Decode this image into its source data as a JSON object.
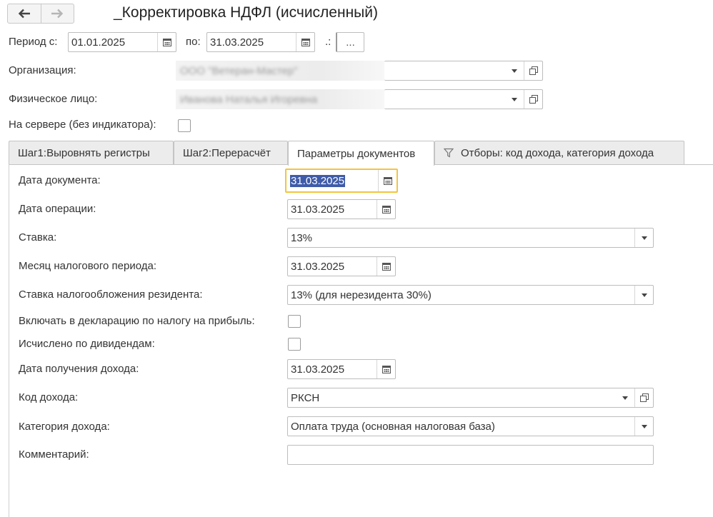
{
  "window": {
    "title": "_Корректировка НДФЛ (исчисленный)"
  },
  "period": {
    "from_label": "Период с:",
    "from_value": "01.01.2025",
    "to_label": "по:",
    "to_value": "31.03.2025",
    "sep": ".:",
    "more_label": "..."
  },
  "organization": {
    "label": "Организация:",
    "value": "ООО \"Ветеран-Мастер\""
  },
  "person": {
    "label": "Физическое лицо:",
    "value": "Иванова Наталья Игоревна"
  },
  "server": {
    "label": "На сервере (без индикатора):"
  },
  "tabs": [
    {
      "label": "Шаг1:Выровнять регистры"
    },
    {
      "label": "Шаг2:Перерасчёт"
    },
    {
      "label": "Параметры документов"
    },
    {
      "label": "Отборы: код дохода, категория дохода"
    }
  ],
  "params": {
    "doc_date_label": "Дата документа:",
    "doc_date_value": "31.03.2025",
    "op_date_label": "Дата операции:",
    "op_date_value": "31.03.2025",
    "rate_label": "Ставка:",
    "rate_value": "13%",
    "tax_month_label": "Месяц налогового периода:",
    "tax_month_value": "31.03.2025",
    "resident_rate_label": "Ставка налогообложения резидента:",
    "resident_rate_value": "13% (для нерезидента 30%)",
    "include_decl_label": "Включать в декларацию по налогу на прибыль:",
    "dividends_label": "Исчислено по дивидендам:",
    "income_date_label": "Дата получения дохода:",
    "income_date_value": "31.03.2025",
    "income_code_label": "Код дохода:",
    "income_code_value": "РКСН",
    "income_cat_label": "Категория дохода:",
    "income_cat_value": "Оплата труда (основная налоговая база)",
    "comment_label": "Комментарий:",
    "comment_value": ""
  },
  "colors": {
    "focus_border": "#f3c43f",
    "selection": "#3f5ba9"
  }
}
